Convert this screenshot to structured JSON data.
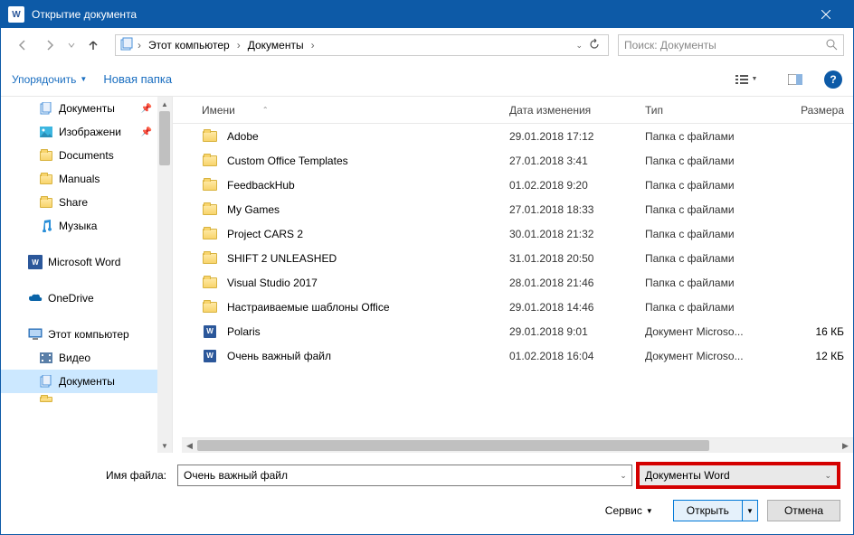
{
  "titlebar": {
    "title": "Открытие документа"
  },
  "path": {
    "seg1": "Этот компьютер",
    "seg2": "Документы"
  },
  "search": {
    "placeholder": "Поиск: Документы"
  },
  "toolbar": {
    "organize": "Упорядочить",
    "newfolder": "Новая папка"
  },
  "sidebar": {
    "items": [
      {
        "label": "Документы",
        "kind": "doc",
        "pin": true
      },
      {
        "label": "Изображени",
        "kind": "img",
        "pin": true
      },
      {
        "label": "Documents",
        "kind": "folder"
      },
      {
        "label": "Manuals",
        "kind": "folder"
      },
      {
        "label": "Share",
        "kind": "folder"
      },
      {
        "label": "Музыка",
        "kind": "music"
      }
    ],
    "word": "Microsoft Word",
    "onedrive": "OneDrive",
    "thispc": "Этот компьютер",
    "videos": "Видео",
    "documents": "Документы"
  },
  "columns": {
    "name": "Имени",
    "date": "Дата изменения",
    "type": "Тип",
    "size": "Размера"
  },
  "files": [
    {
      "name": "Adobe",
      "date": "29.01.2018 17:12",
      "type": "Папка с файлами",
      "size": "",
      "kind": "folder"
    },
    {
      "name": "Custom Office Templates",
      "date": "27.01.2018 3:41",
      "type": "Папка с файлами",
      "size": "",
      "kind": "folder"
    },
    {
      "name": "FeedbackHub",
      "date": "01.02.2018 9:20",
      "type": "Папка с файлами",
      "size": "",
      "kind": "folder"
    },
    {
      "name": "My Games",
      "date": "27.01.2018 18:33",
      "type": "Папка с файлами",
      "size": "",
      "kind": "folder"
    },
    {
      "name": "Project CARS 2",
      "date": "30.01.2018 21:32",
      "type": "Папка с файлами",
      "size": "",
      "kind": "folder"
    },
    {
      "name": "SHIFT 2 UNLEASHED",
      "date": "31.01.2018 20:50",
      "type": "Папка с файлами",
      "size": "",
      "kind": "folder"
    },
    {
      "name": "Visual Studio 2017",
      "date": "28.01.2018 21:46",
      "type": "Папка с файлами",
      "size": "",
      "kind": "folder"
    },
    {
      "name": "Настраиваемые шаблоны Office",
      "date": "29.01.2018 14:46",
      "type": "Папка с файлами",
      "size": "",
      "kind": "folder"
    },
    {
      "name": "Polaris",
      "date": "29.01.2018 9:01",
      "type": "Документ Microso...",
      "size": "16 КБ",
      "kind": "word"
    },
    {
      "name": "Очень важный файл",
      "date": "01.02.2018 16:04",
      "type": "Документ Microso...",
      "size": "12 КБ",
      "kind": "word"
    }
  ],
  "bottom": {
    "filelabel": "Имя файла:",
    "filename": "Очень важный файл",
    "filter": "Документы Word",
    "service": "Сервис",
    "open": "Открыть",
    "cancel": "Отмена"
  }
}
